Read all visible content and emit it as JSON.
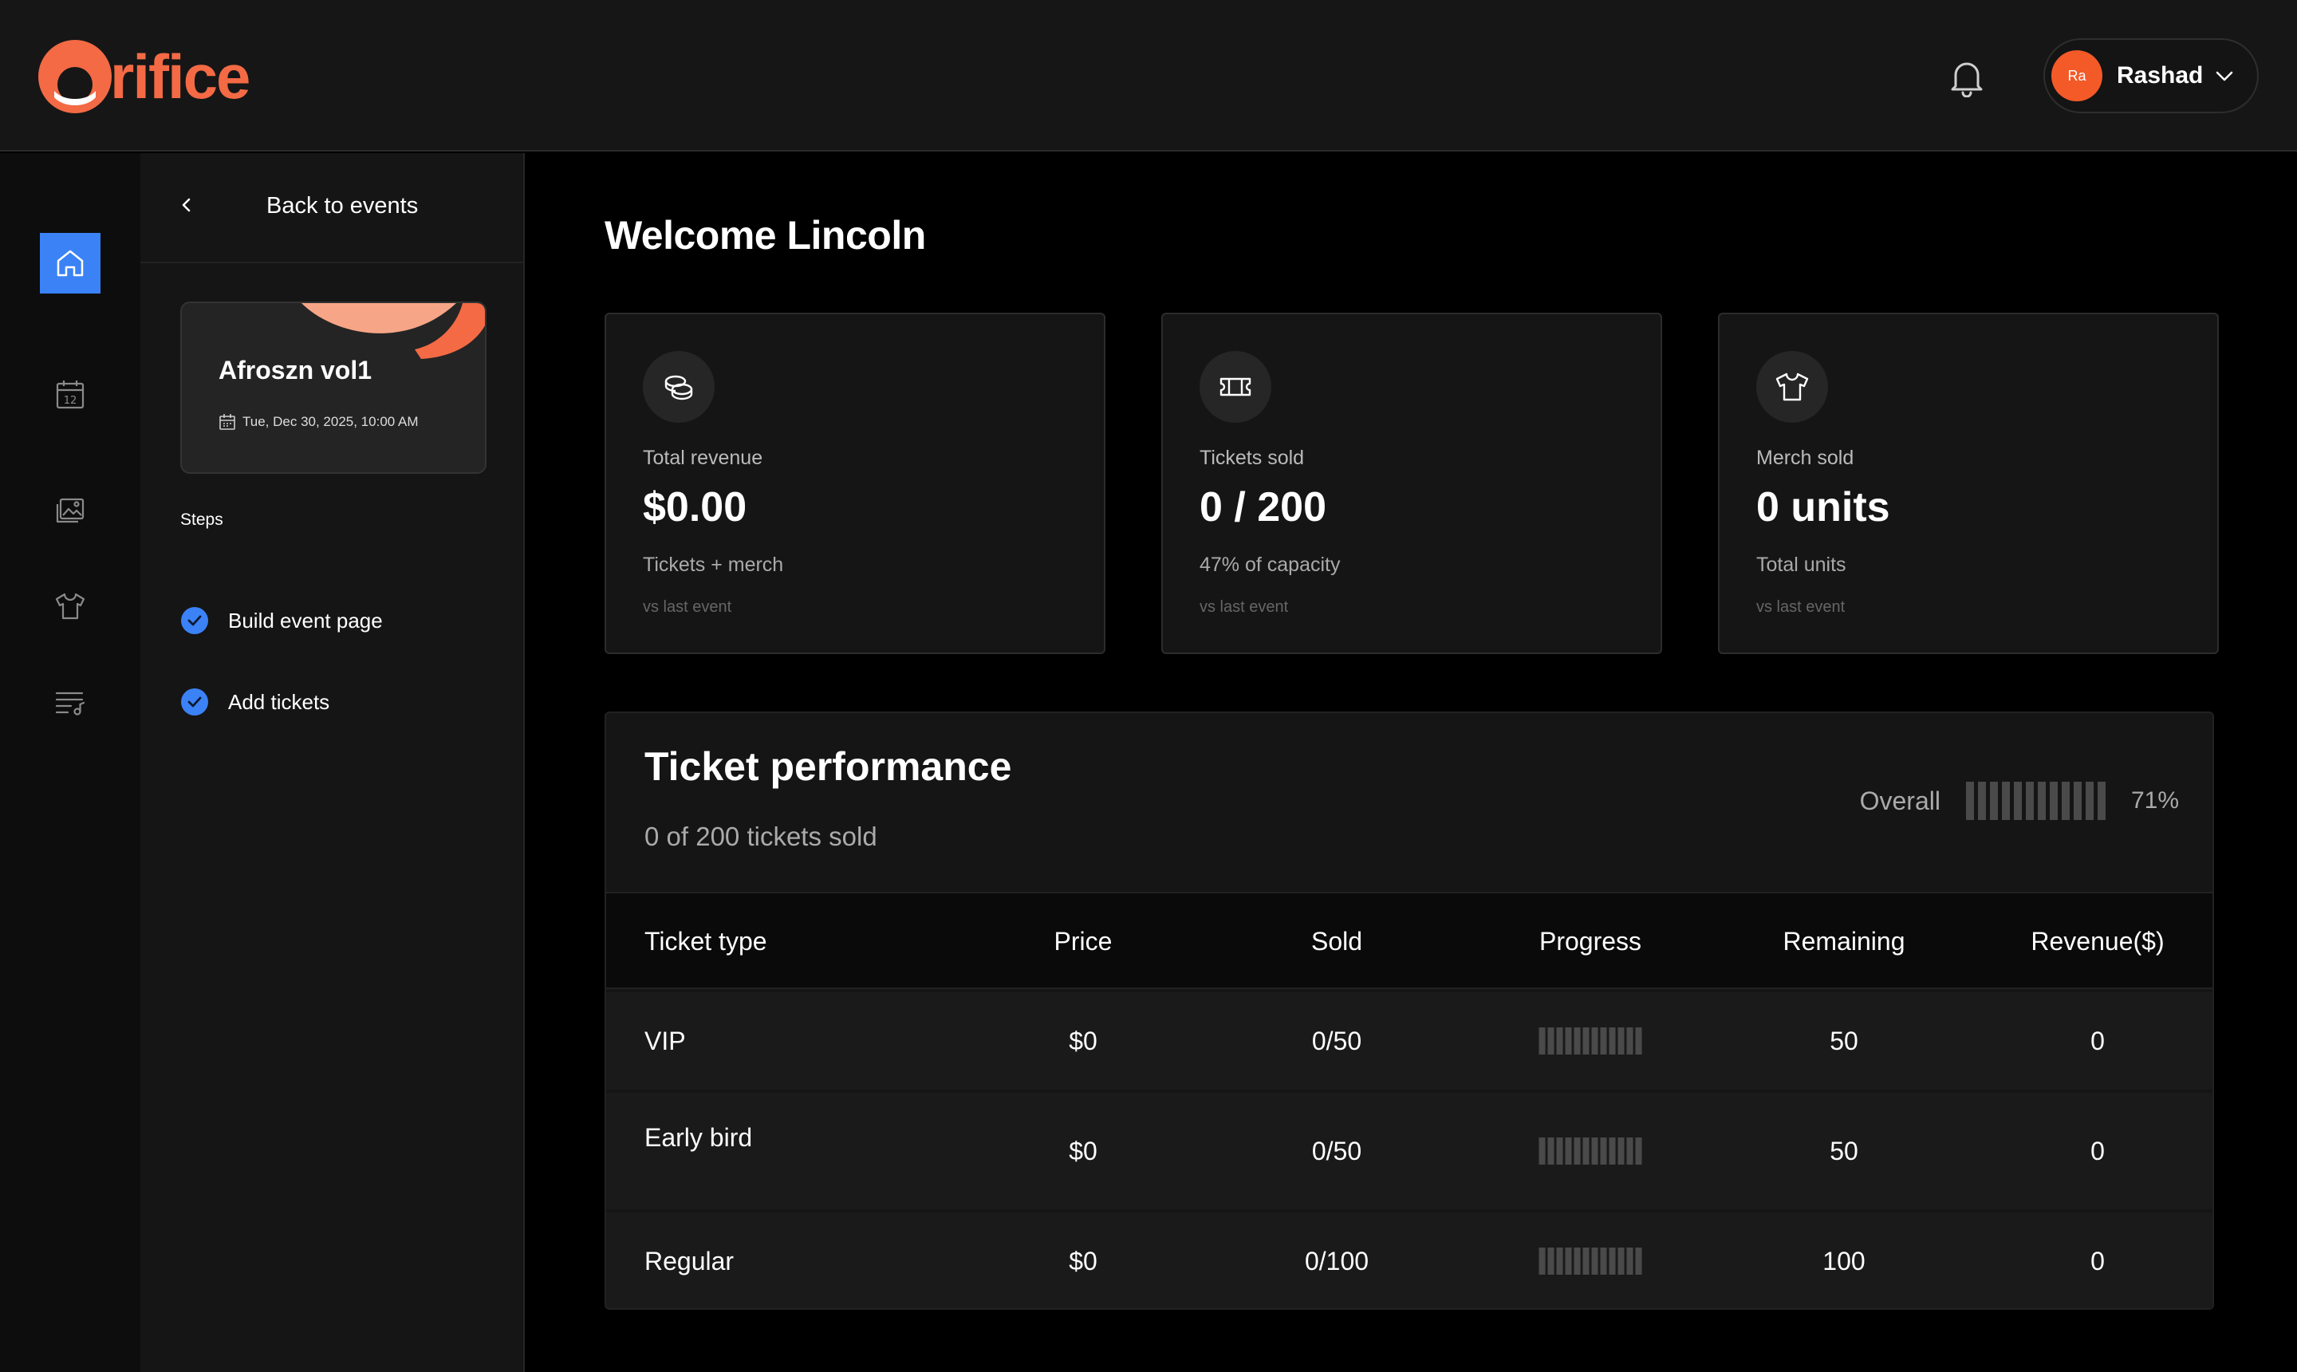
{
  "brand": {
    "logo_text": "rifice",
    "accent": "#f36a45"
  },
  "header": {
    "user": {
      "initials": "Ra",
      "name": "Rashad"
    }
  },
  "rail": {
    "items": [
      {
        "icon": "home-icon",
        "active": true
      },
      {
        "icon": "calendar-icon",
        "active": false
      },
      {
        "icon": "gallery-icon",
        "active": false
      },
      {
        "icon": "tshirt-icon",
        "active": false
      },
      {
        "icon": "playlist-icon",
        "active": false
      }
    ],
    "calendar_day": "12"
  },
  "steps_panel": {
    "back_label": "Back to events",
    "event": {
      "title": "Afroszn vol1",
      "date": "Tue, Dec 30, 2025, 10:00 AM"
    },
    "steps_title": "Steps",
    "steps": [
      {
        "label": "Build event page",
        "done": true
      },
      {
        "label": "Add tickets",
        "done": true
      }
    ]
  },
  "main": {
    "welcome": "Welcome Lincoln",
    "stats": [
      {
        "icon": "coins-icon",
        "label": "Total revenue",
        "value": "$0.00",
        "sub": "Tickets + merch",
        "foot": "vs last event"
      },
      {
        "icon": "ticket-icon",
        "label": "Tickets sold",
        "value": "0 / 200",
        "sub": "47% of capacity",
        "foot": "vs last event"
      },
      {
        "icon": "tshirt-icon",
        "label": "Merch sold",
        "value": "0 units",
        "sub": "Total units",
        "foot": "vs last event"
      }
    ],
    "performance": {
      "title": "Ticket performance",
      "subtitle": "0 of 200 tickets sold",
      "overall_label": "Overall",
      "overall_pct": "71%",
      "columns": [
        "Ticket type",
        "Price",
        "Sold",
        "Progress",
        "Remaining",
        "Revenue($)"
      ],
      "rows": [
        {
          "type": "VIP",
          "price": "$0",
          "sold": "0/50",
          "progress": 0,
          "remaining": "50",
          "revenue": "0"
        },
        {
          "type": "Early bird",
          "price": "$0",
          "sold": "0/50",
          "progress": 0,
          "remaining": "50",
          "revenue": "0"
        },
        {
          "type": "Regular",
          "price": "$0",
          "sold": "0/100",
          "progress": 0,
          "remaining": "100",
          "revenue": "0"
        }
      ]
    }
  }
}
